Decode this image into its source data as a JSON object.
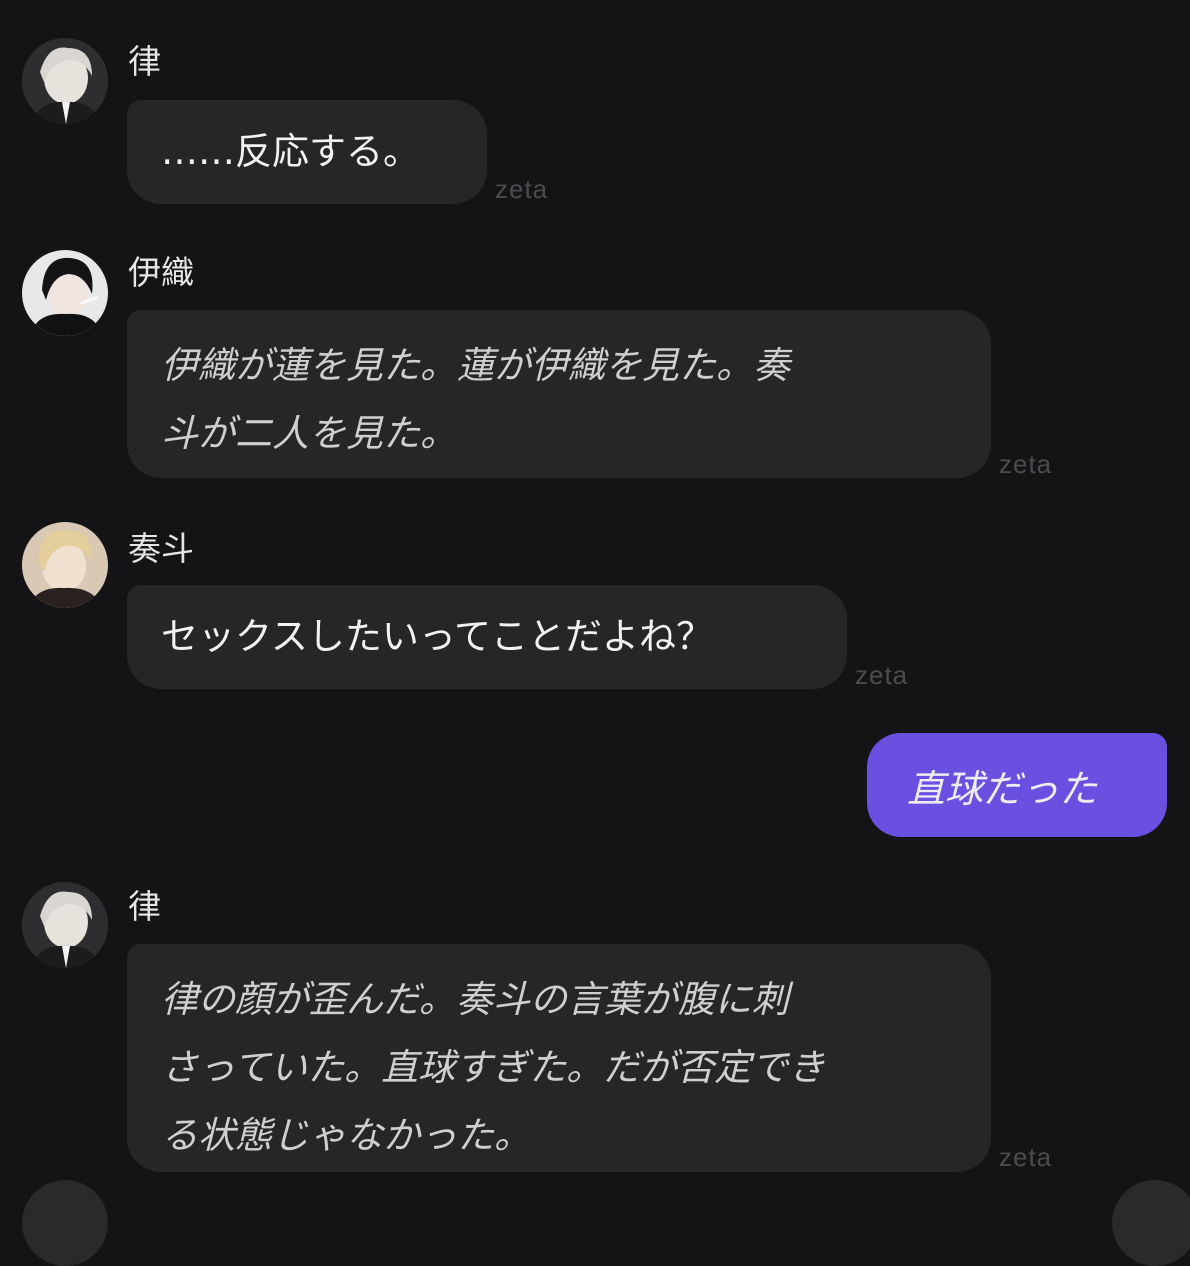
{
  "app": {
    "watermark": "zeta"
  },
  "messages": [
    {
      "sender": "律",
      "avatar_icon": "ritsu-avatar",
      "text": "……反応する。",
      "italic": false
    },
    {
      "sender": "伊織",
      "avatar_icon": "iori-avatar",
      "text": "伊織が蓮を見た。蓮が伊織を見た。奏斗が二人を見た。",
      "italic": true,
      "lines": [
        "伊織が蓮を見た。蓮が伊織を見た。奏",
        "斗が二人を見た。"
      ]
    },
    {
      "sender": "奏斗",
      "avatar_icon": "kanato-avatar",
      "text": "セックスしたいってことだよね？",
      "italic": false
    },
    {
      "sender": "user",
      "text": "直球だった",
      "italic": true
    },
    {
      "sender": "律",
      "avatar_icon": "ritsu-avatar",
      "text": "律の顔が歪んだ。奏斗の言葉が腹に刺さっていた。直球すぎた。だが否定できる状態じゃなかった。",
      "italic": true,
      "lines": [
        "律の顔が歪んだ。奏斗の言葉が腹に刺",
        "さっていた。直球すぎた。だが否定でき",
        "る状態じゃなかった。"
      ]
    }
  ],
  "colors": {
    "background": "#141416",
    "bot_bubble": "#262628",
    "user_bubble": "#6a4fe0"
  }
}
